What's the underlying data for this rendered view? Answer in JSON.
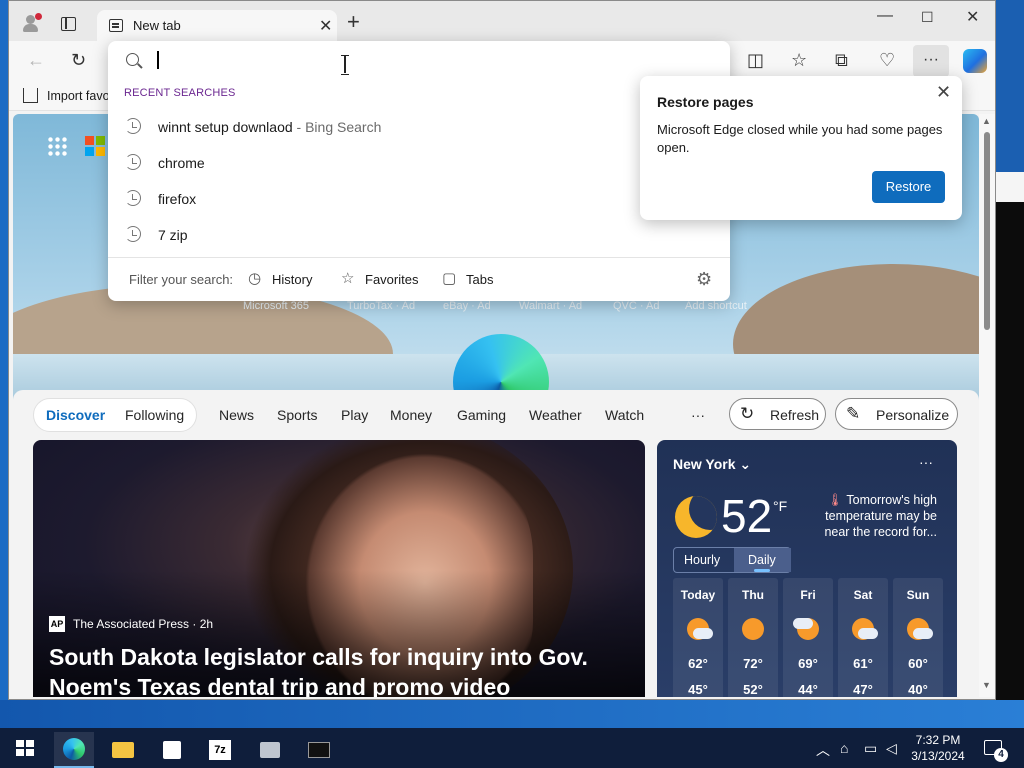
{
  "browser": {
    "tab_title": "New tab",
    "favorites_bar": {
      "import_label": "Import favo"
    }
  },
  "omnibox": {
    "value": "",
    "recent_header": "RECENT SEARCHES",
    "suggestions": [
      {
        "text": "winnt setup downlaod",
        "meta": " - Bing Search"
      },
      {
        "text": "chrome",
        "meta": ""
      },
      {
        "text": "firefox",
        "meta": ""
      },
      {
        "text": "7 zip",
        "meta": ""
      }
    ],
    "filter_label": "Filter your search:",
    "filters": [
      "History",
      "Favorites",
      "Tabs"
    ]
  },
  "restore_popup": {
    "title": "Restore pages",
    "message": "Microsoft Edge closed while you had some pages open.",
    "button": "Restore"
  },
  "quick_links": [
    "Microsoft 365",
    "TurboTax · Ad",
    "eBay · Ad",
    "Walmart · Ad",
    "QVC · Ad",
    "Add shortcut"
  ],
  "feed": {
    "nav": {
      "discover": "Discover",
      "following": "Following",
      "items": [
        "News",
        "Sports",
        "Play",
        "Money",
        "Gaming",
        "Weather",
        "Watch"
      ],
      "more": "···",
      "refresh": "Refresh",
      "personalize": "Personalize"
    },
    "hero": {
      "source_logo": "AP",
      "source": "The Associated Press · 2h",
      "headline": "South Dakota legislator calls for inquiry into Gov. Noem's Texas dental trip and promo video"
    },
    "weather": {
      "city": "New York",
      "more": "···",
      "temp": "52",
      "unit": "°F",
      "note": "Tomorrow's high temperature may be near the record for...",
      "toggle": [
        "Hourly",
        "Daily"
      ],
      "days": [
        {
          "name": "Today",
          "hi": "62°",
          "lo": "45°"
        },
        {
          "name": "Thu",
          "hi": "72°",
          "lo": "52°"
        },
        {
          "name": "Fri",
          "hi": "69°",
          "lo": "44°"
        },
        {
          "name": "Sat",
          "hi": "61°",
          "lo": "47°"
        },
        {
          "name": "Sun",
          "hi": "60°",
          "lo": "40°"
        }
      ]
    }
  },
  "taskbar": {
    "clock_time": "7:32 PM",
    "clock_date": "3/13/2024",
    "notification_count": "4"
  },
  "colors": {
    "accent": "#0f6cbd",
    "recent_header": "#6b2790",
    "taskbar": "#0f1e3b"
  }
}
